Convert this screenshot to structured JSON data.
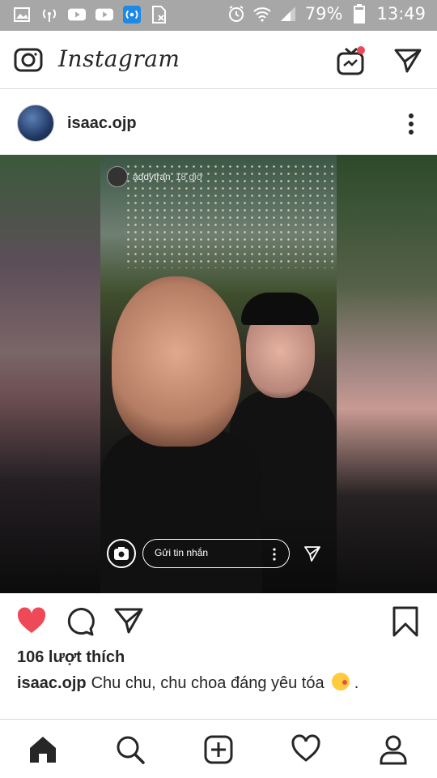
{
  "status_bar": {
    "battery_percent": "79%",
    "time": "13:49",
    "background": "#a7a7a7"
  },
  "header": {
    "logo_text": "Instagram",
    "notification_dot_color": "#ed4956"
  },
  "post": {
    "username": "isaac.ojp",
    "story": {
      "username": "addytran",
      "time": "18 giờ",
      "message_placeholder": "Gửi tin nhắn"
    },
    "liked": true,
    "like_color": "#ed4956",
    "likes_text": "106 lượt thích",
    "caption": {
      "username": "isaac.ojp",
      "text": "Chu chu, chu choa đáng yêu tóa",
      "suffix": " ."
    }
  },
  "bottom_nav": {
    "items": [
      "home-icon",
      "search-icon",
      "add-post-icon",
      "activity-heart-icon",
      "profile-icon"
    ],
    "active": "home-icon"
  }
}
